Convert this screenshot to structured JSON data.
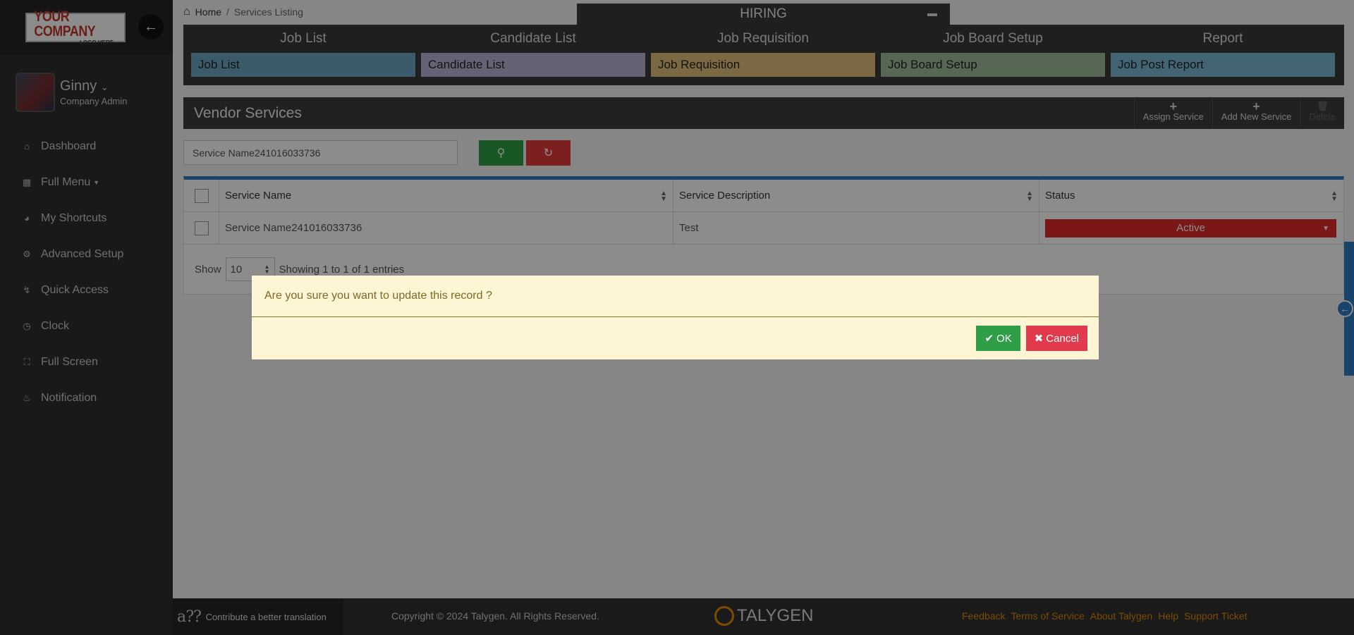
{
  "brand": {
    "logo_line1": "YOUR COMPANY",
    "logo_line2": "LOGO HERE"
  },
  "user": {
    "name": "Ginny",
    "role": "Company Admin"
  },
  "nav": [
    {
      "label": "Dashboard",
      "icon": "home-icon"
    },
    {
      "label": "Full Menu",
      "icon": "grid-icon"
    },
    {
      "label": "My Shortcuts",
      "icon": "speedometer-icon"
    },
    {
      "label": "Advanced Setup",
      "icon": "gear-icon"
    },
    {
      "label": "Quick Access",
      "icon": "bolt-icon"
    },
    {
      "label": "Clock",
      "icon": "clock-icon"
    },
    {
      "label": "Full Screen",
      "icon": "fullscreen-icon"
    },
    {
      "label": "Notification",
      "icon": "bell-icon"
    }
  ],
  "breadcrumb": {
    "home": "Home",
    "separator": "/",
    "current": "Services Listing"
  },
  "hiring": {
    "title": "HIRING",
    "columns": [
      {
        "heading": "Job List",
        "button": "Job List",
        "color": "#6ea6c2"
      },
      {
        "heading": "Candidate List",
        "button": "Candidate List",
        "color": "#b9b3d6"
      },
      {
        "heading": "Job Requisition",
        "button": "Job Requisition",
        "color": "#e0c07a"
      },
      {
        "heading": "Job Board Setup",
        "button": "Job Board Setup",
        "color": "#9dbd9a"
      },
      {
        "heading": "Report",
        "button": "Job Post Report",
        "color": "#7ab6cf"
      }
    ]
  },
  "vendor_services": {
    "title": "Vendor Services",
    "actions": {
      "assign": "Assign Service",
      "add": "Add New Service",
      "delete": "Delete"
    }
  },
  "search": {
    "value": "Service Name241016033736"
  },
  "table": {
    "headers": [
      "Service Name",
      "Service Description",
      "Status"
    ],
    "rows": [
      {
        "service_name": "Service Name241016033736",
        "description": "Test",
        "status": "Active"
      }
    ],
    "show_label": "Show",
    "page_size": "10",
    "entries_info": "Showing 1 to 1 of 1 entries"
  },
  "footer": {
    "translate": "Contribute a better translation",
    "copyright": "Copyright © 2024 Talygen. All Rights Reserved.",
    "brand": "TALYGEN",
    "links": [
      "Feedback",
      "Terms of Service",
      "About Talygen",
      "Help",
      "Support Ticket"
    ]
  },
  "dialog": {
    "message": "Are you sure you want to update this record ?",
    "ok_label": "OK",
    "cancel_label": "Cancel"
  },
  "colors": {
    "accent_blue": "#2d7bc4",
    "success": "#2e9e47",
    "danger": "#e03a3a",
    "footer_link": "#e08a00"
  }
}
